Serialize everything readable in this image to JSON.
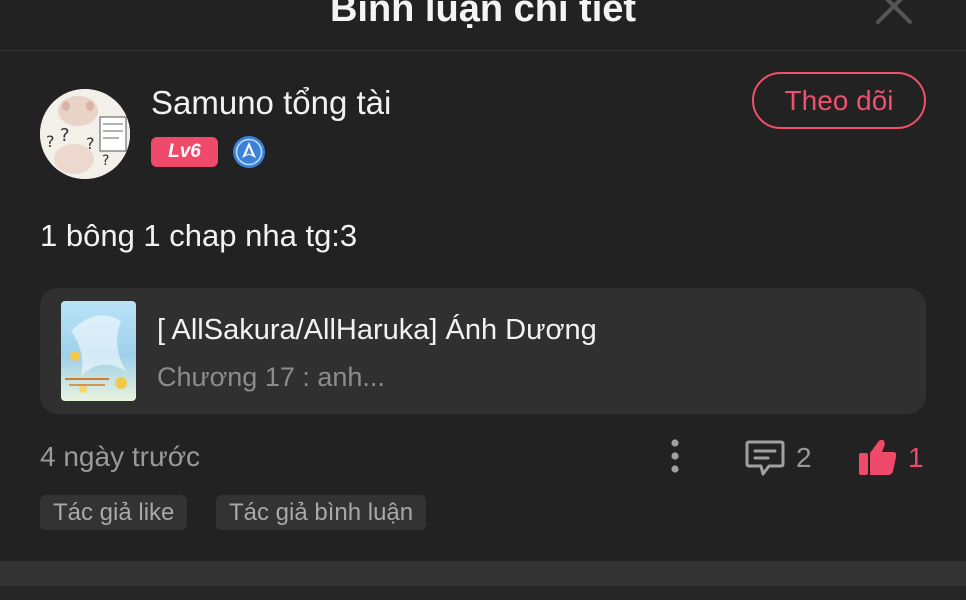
{
  "header": {
    "title": "Bình luận chi tiết"
  },
  "user": {
    "name": "Samuno tổng tài",
    "level": "Lv6",
    "follow_label": "Theo dõi"
  },
  "comment": {
    "text": "1 bông 1 chap nha tg:3"
  },
  "reference": {
    "title": "[ AllSakura/AllHaruka] Ánh Dương",
    "chapter": "Chương 17 : anh..."
  },
  "footer": {
    "timestamp": "4 ngày trước",
    "reply_count": "2",
    "like_count": "1"
  },
  "tags": [
    "Tác giả like",
    "Tác giả bình luận"
  ],
  "colors": {
    "accent": "#ef4a6a",
    "background": "#222222",
    "card": "#303030",
    "muted_text": "#9a9a9a"
  },
  "icons": [
    "close-icon",
    "rank-badge-icon",
    "more-vertical-icon",
    "comment-icon",
    "thumbs-up-icon"
  ]
}
